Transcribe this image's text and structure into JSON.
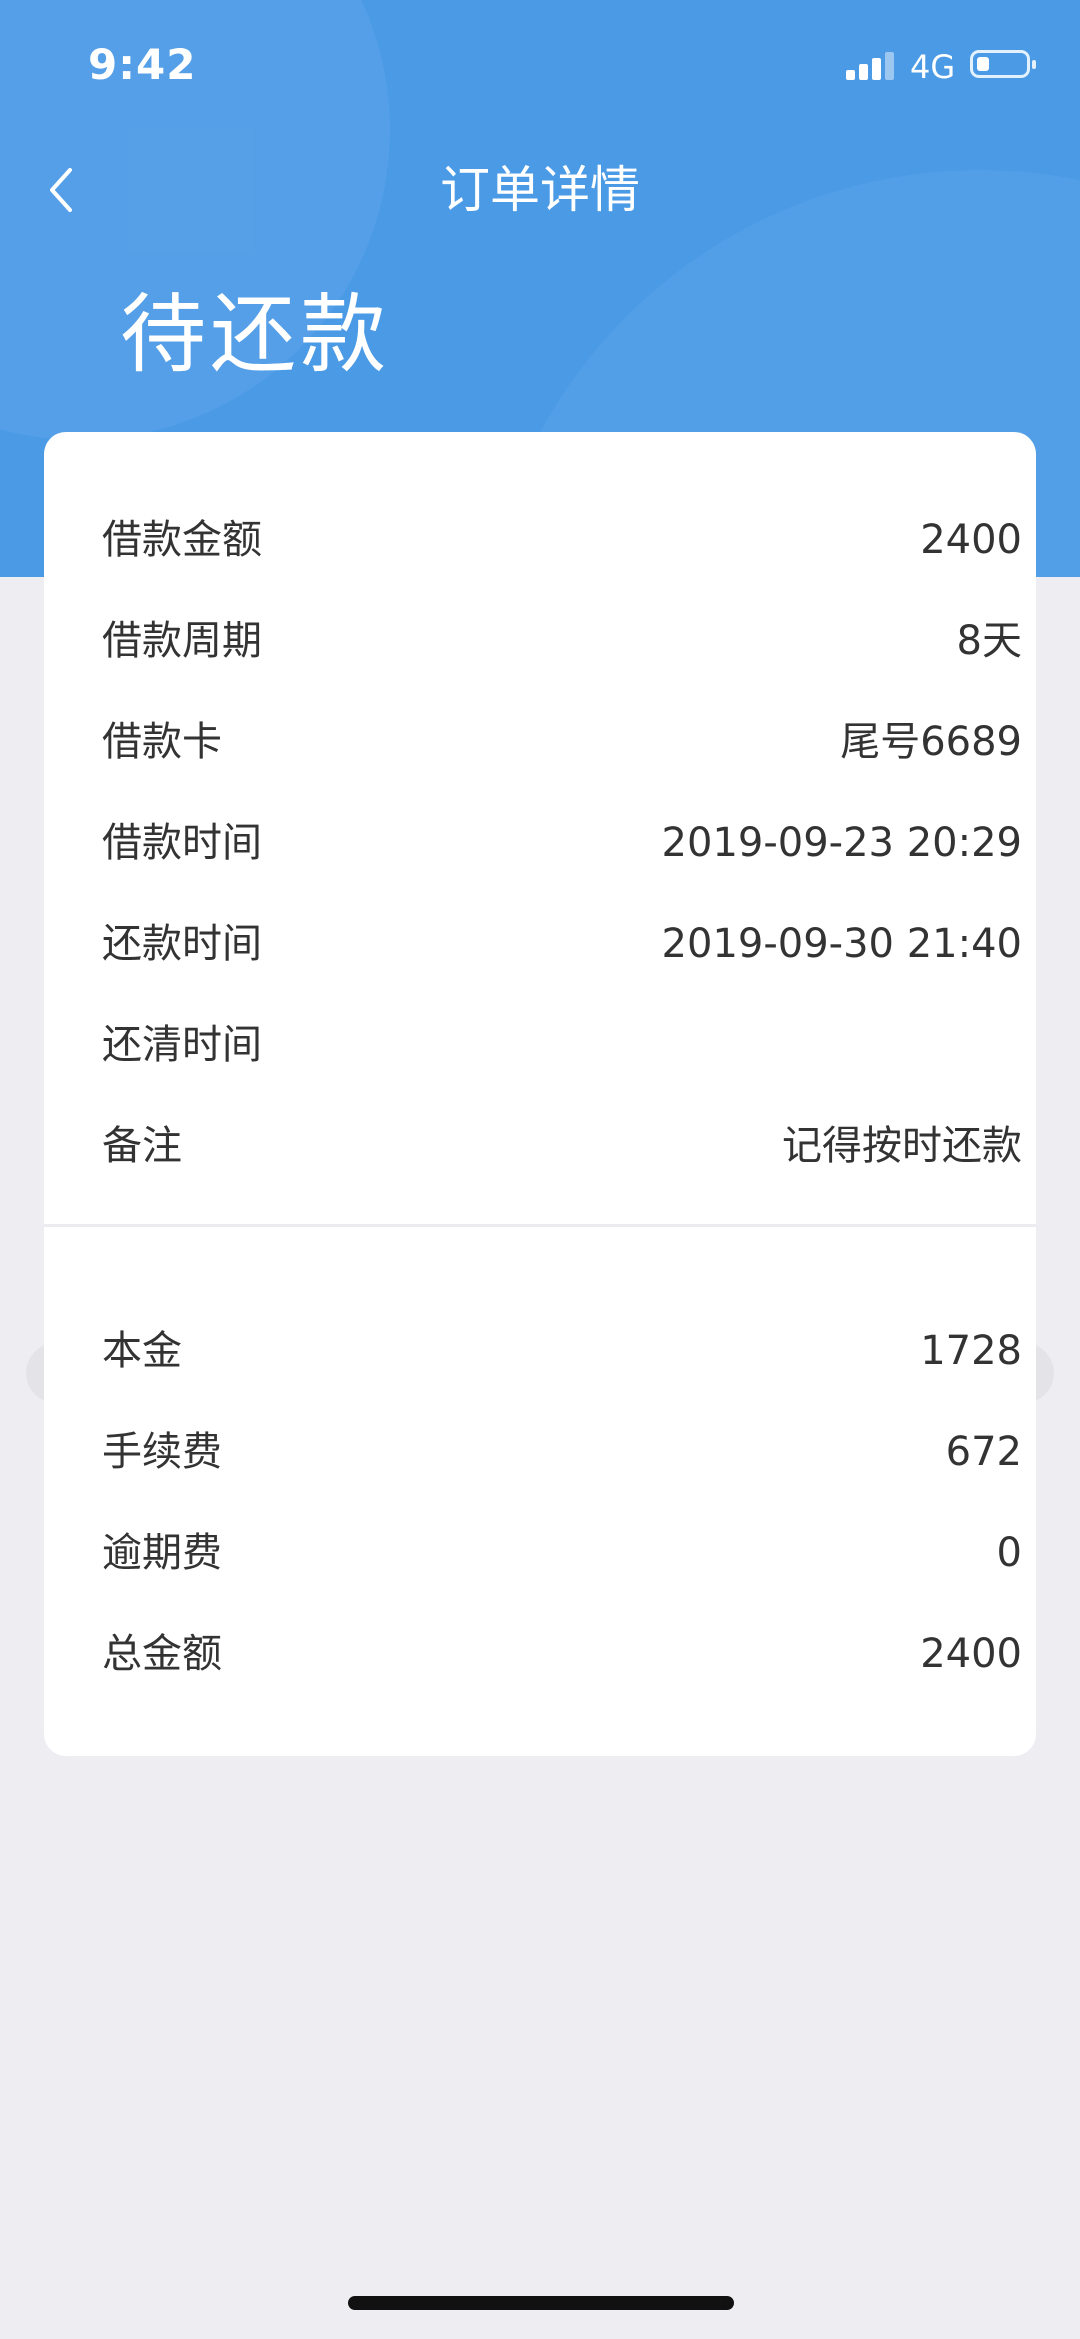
{
  "status_bar": {
    "time": "9:42",
    "network": "4G",
    "signal_icon": "signal-bars-icon",
    "battery_icon": "battery-icon",
    "battery_level": 0.2
  },
  "nav": {
    "title": "订单详情",
    "back_icon": "chevron-left-icon"
  },
  "order_status": "待还款",
  "colors": {
    "header_bg": "#4a9ae6",
    "page_bg": "#eeeef2",
    "card_bg": "#ffffff"
  },
  "details": [
    {
      "label": "借款金额",
      "value": "2400"
    },
    {
      "label": "借款周期",
      "value": "8天"
    },
    {
      "label": "借款卡",
      "value": "尾号6689"
    },
    {
      "label": "借款时间",
      "value": "2019-09-23 20:29"
    },
    {
      "label": "还款时间",
      "value": "2019-09-30 21:40"
    },
    {
      "label": "还清时间",
      "value": ""
    },
    {
      "label": "备注",
      "value": "记得按时还款"
    }
  ],
  "fees": [
    {
      "label": "本金",
      "value": "1728"
    },
    {
      "label": "手续费",
      "value": "672"
    },
    {
      "label": "逾期费",
      "value": "0"
    },
    {
      "label": "总金额",
      "value": "2400"
    }
  ]
}
